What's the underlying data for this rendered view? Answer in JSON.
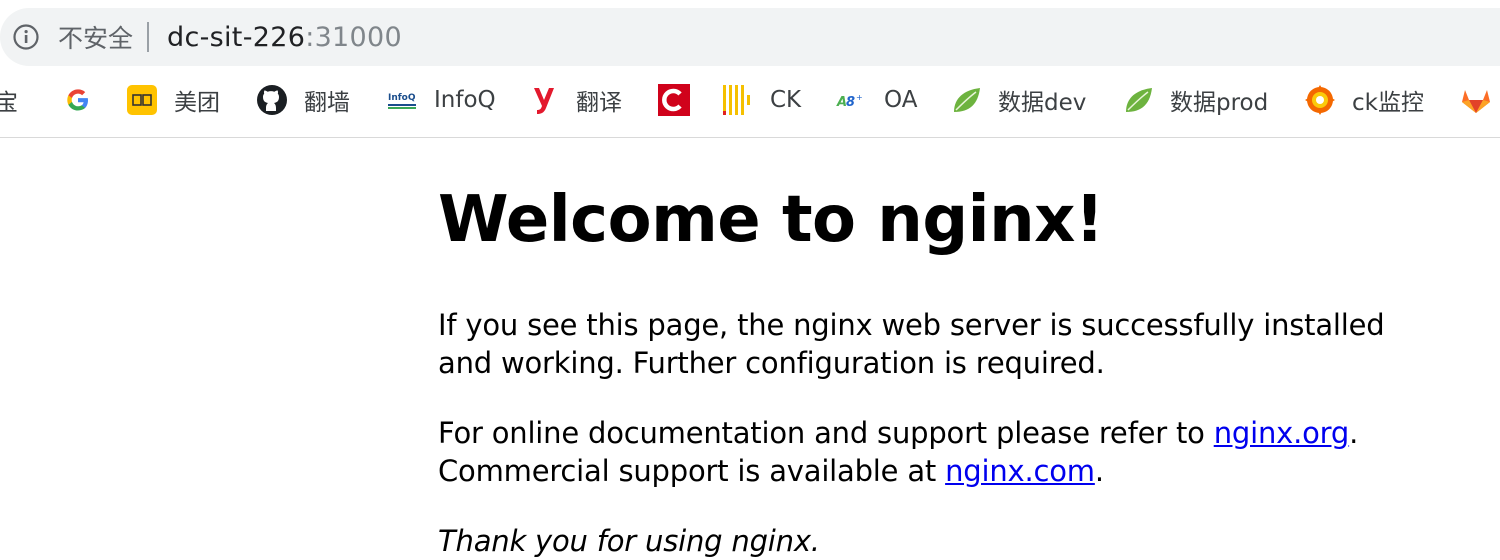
{
  "address_bar": {
    "security_label": "不安全",
    "host": "dc-sit-226",
    "port": ":31000"
  },
  "bookmarks": [
    {
      "icon": "taobao-partial",
      "label": "]宝"
    },
    {
      "icon": "google-icon",
      "label": ""
    },
    {
      "icon": "meituan-icon",
      "label": "美团"
    },
    {
      "icon": "github-icon",
      "label": "翻墙"
    },
    {
      "icon": "infoq-icon",
      "label": "InfoQ"
    },
    {
      "icon": "youdao-icon",
      "label": "翻译"
    },
    {
      "icon": "c-red-icon",
      "label": ""
    },
    {
      "icon": "ck-bars-icon",
      "label": "CK"
    },
    {
      "icon": "oa-icon",
      "label": "OA"
    },
    {
      "icon": "spring-leaf-icon",
      "label": "数据dev"
    },
    {
      "icon": "spring-leaf-icon",
      "label": "数据prod"
    },
    {
      "icon": "grafana-icon",
      "label": "ck监控"
    },
    {
      "icon": "gitlab-icon",
      "label": ""
    }
  ],
  "page": {
    "heading": "Welcome to nginx!",
    "para1": "If you see this page, the nginx web server is successfully installed and working. Further configuration is required.",
    "para2_prefix": "For online documentation and support please refer to ",
    "link_org": "nginx.org",
    "para2_mid": ".",
    "para2_line2": "Commercial support is available at ",
    "link_com": "nginx.com",
    "para2_end": ".",
    "para3": "Thank you for using nginx."
  },
  "colors": {
    "link": "#0000ee",
    "toolbar_bg": "#f1f3f4"
  }
}
